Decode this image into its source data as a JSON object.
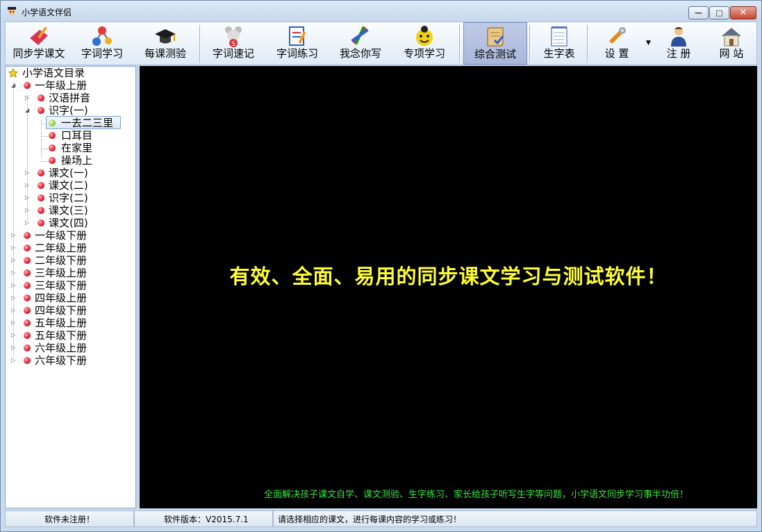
{
  "window": {
    "title": "小学语文伴侣",
    "minimize_label": "—",
    "maximize_label": "□",
    "close_label": "✕"
  },
  "toolbar": {
    "items": [
      {
        "label": "同步学课文",
        "icon": "book-pencil-icon"
      },
      {
        "label": "字词学习",
        "icon": "molecule-icon"
      },
      {
        "label": "每课测验",
        "icon": "graduation-cap-icon"
      },
      {
        "label": "字词速记",
        "icon": "mouse-mascot-icon"
      },
      {
        "label": "字词练习",
        "icon": "checklist-pencil-icon"
      },
      {
        "label": "我念你写",
        "icon": "pens-icon"
      },
      {
        "label": "专项学习",
        "icon": "ladybug-icon"
      },
      {
        "label": "综合测试",
        "icon": "scroll-icon",
        "active": true
      },
      {
        "label": "生字表",
        "icon": "notepad-icon"
      },
      {
        "label": "设 置",
        "icon": "wrench-icon"
      },
      {
        "label": "注 册",
        "icon": "user-icon"
      },
      {
        "label": "网 站",
        "icon": "home-icon"
      }
    ],
    "dropdown_arrow": "▼"
  },
  "tree": {
    "root": "小学语文目录",
    "nodes": [
      {
        "label": "一年级上册"
      },
      {
        "label": "汉语拼音"
      },
      {
        "label": "识字(一)"
      },
      {
        "label": "一去二三里",
        "selected": true
      },
      {
        "label": "口耳目"
      },
      {
        "label": "在家里"
      },
      {
        "label": "操场上"
      },
      {
        "label": "课文(一)"
      },
      {
        "label": "课文(二)"
      },
      {
        "label": "识字(二)"
      },
      {
        "label": "课文(三)"
      },
      {
        "label": "课文(四)"
      },
      {
        "label": "一年级下册"
      },
      {
        "label": "二年级上册"
      },
      {
        "label": "二年级下册"
      },
      {
        "label": "三年级上册"
      },
      {
        "label": "三年级下册"
      },
      {
        "label": "四年级上册"
      },
      {
        "label": "四年级下册"
      },
      {
        "label": "五年级上册"
      },
      {
        "label": "五年级下册"
      },
      {
        "label": "六年级上册"
      },
      {
        "label": "六年级下册"
      }
    ]
  },
  "main": {
    "headline": "有效、全面、易用的同步课文学习与测试软件！",
    "subline": "全面解决孩子课文自学、课文测验、生字练习、家长给孩子听写生字等问题，小学语文同步学习事半功倍！",
    "headline_color": "#ffff33",
    "subline_color": "#39e63f"
  },
  "status": {
    "registration": "软件未注册！",
    "version": "软件版本：V2015.7.1",
    "hint": "请选择相应的课文，进行每课内容的学习或练习！"
  }
}
